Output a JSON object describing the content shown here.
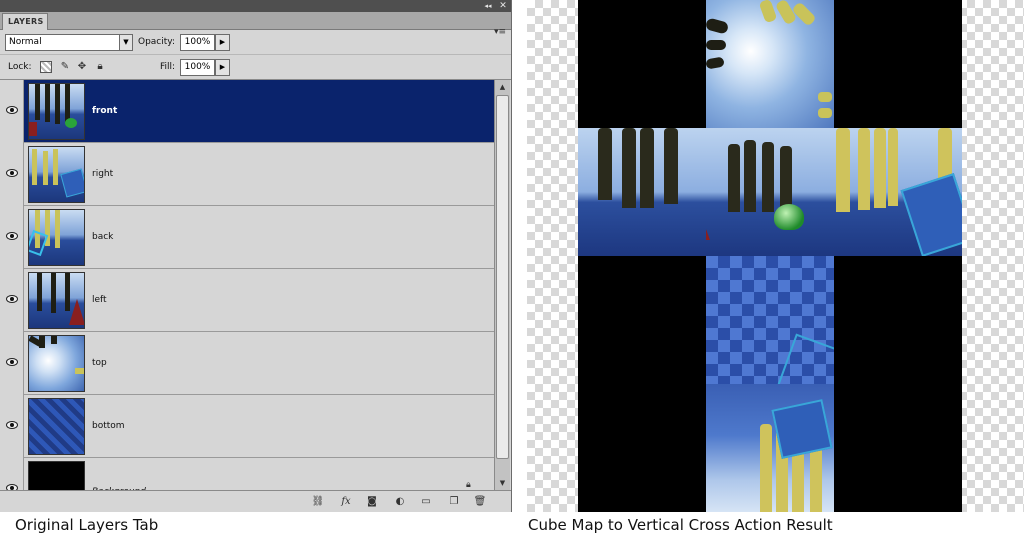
{
  "panel": {
    "tab_label": "LAYERS",
    "collapse_glyph": "◂◂",
    "close_glyph": "✕",
    "menu_glyph": "▾≡",
    "blend_mode": "Normal",
    "opacity_label": "Opacity:",
    "opacity_value": "100%",
    "lock_label": "Lock:",
    "fill_label": "Fill:",
    "fill_value": "100%",
    "layers": [
      {
        "name": "front",
        "selected": true,
        "visible": true
      },
      {
        "name": "right",
        "selected": false,
        "visible": true
      },
      {
        "name": "back",
        "selected": false,
        "visible": true
      },
      {
        "name": "left",
        "selected": false,
        "visible": true
      },
      {
        "name": "top",
        "selected": false,
        "visible": true
      },
      {
        "name": "bottom",
        "selected": false,
        "visible": true
      },
      {
        "name": "Background",
        "selected": false,
        "visible": true,
        "locked": true
      }
    ],
    "footer_icons": [
      "link-layers-icon",
      "fx-icon",
      "add-mask-icon",
      "adjustment-layer-icon",
      "new-group-icon",
      "new-layer-icon",
      "delete-icon"
    ]
  },
  "captions": {
    "left": "Original Layers Tab",
    "right": "Cube Map to Vertical Cross Action Result"
  },
  "colors": {
    "selected_row": "#0a236c",
    "panel_bg": "#d6d6d6",
    "header_bg": "#4f4f4f"
  }
}
